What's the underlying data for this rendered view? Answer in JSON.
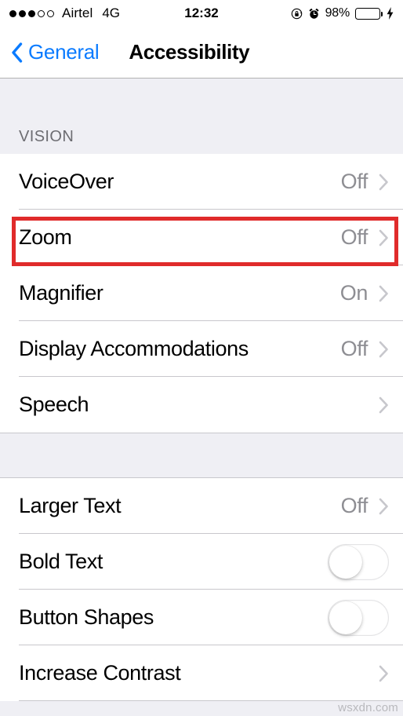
{
  "status_bar": {
    "signal_dots_filled": 3,
    "signal_dots_total": 5,
    "carrier": "Airtel",
    "network": "4G",
    "time": "12:32",
    "battery_percent": "98%",
    "battery_level": 98,
    "battery_color": "#4CD964",
    "icons": [
      "rotation-lock-icon",
      "alarm-clock-icon",
      "battery-icon",
      "charging-bolt-icon"
    ]
  },
  "nav_bar": {
    "back_label": "General",
    "title": "Accessibility",
    "tint_color": "#0a7bff"
  },
  "sections": [
    {
      "header": "VISION",
      "rows": [
        {
          "label": "VoiceOver",
          "value": "Off",
          "accessory": "disclosure"
        },
        {
          "label": "Zoom",
          "value": "Off",
          "accessory": "disclosure",
          "highlighted": true
        },
        {
          "label": "Magnifier",
          "value": "On",
          "accessory": "disclosure"
        },
        {
          "label": "Display Accommodations",
          "value": "Off",
          "accessory": "disclosure"
        },
        {
          "label": "Speech",
          "value": "",
          "accessory": "disclosure"
        }
      ]
    },
    {
      "header": "",
      "rows": [
        {
          "label": "Larger Text",
          "value": "Off",
          "accessory": "disclosure"
        },
        {
          "label": "Bold Text",
          "value": "",
          "accessory": "toggle",
          "toggle_on": false
        },
        {
          "label": "Button Shapes",
          "value": "",
          "accessory": "toggle",
          "toggle_on": false
        },
        {
          "label": "Increase Contrast",
          "value": "",
          "accessory": "disclosure"
        }
      ]
    }
  ],
  "highlight": {
    "color": "#e02b2b",
    "target": "Zoom"
  },
  "watermark": "wsxdn.com"
}
